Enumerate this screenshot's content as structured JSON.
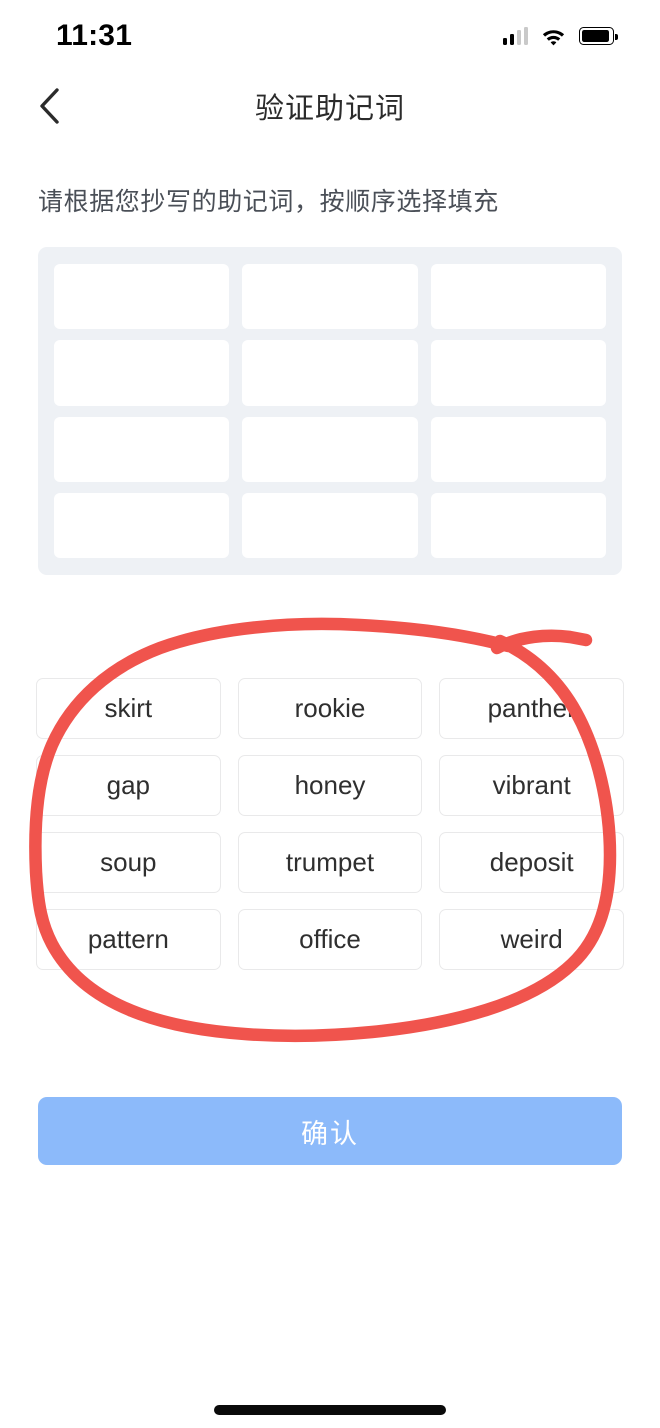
{
  "status_bar": {
    "time": "11:31",
    "cellular_icon": "cellular-signal-icon",
    "cellular_bars_filled": 2,
    "cellular_bars_total": 4,
    "wifi_icon": "wifi-icon",
    "battery_icon": "battery-icon",
    "battery_level_percent": 92
  },
  "nav": {
    "back_icon": "chevron-left-icon",
    "title": "验证助记词"
  },
  "instruction": "请根据您抄写的助记词，按顺序选择填充",
  "slots": {
    "count": 12,
    "filled_values": [
      "",
      "",
      "",
      "",
      "",
      "",
      "",
      "",
      "",
      "",
      "",
      ""
    ],
    "panel_bg": "#eef1f5",
    "slot_bg": "#ffffff"
  },
  "word_bank": {
    "words": [
      "skirt",
      "rookie",
      "panther",
      "gap",
      "honey",
      "vibrant",
      "soup",
      "trumpet",
      "deposit",
      "pattern",
      "office",
      "weird"
    ]
  },
  "confirm": {
    "label": "确认",
    "bg_color": "#8cbafa",
    "text_color": "#ffffff",
    "enabled": false
  },
  "annotation": {
    "type": "hand-drawn-ellipse",
    "color": "#f0544d",
    "stroke_width": 12,
    "target": "word-bank-grid"
  },
  "home_indicator": {
    "color": "#0a0a0a"
  }
}
